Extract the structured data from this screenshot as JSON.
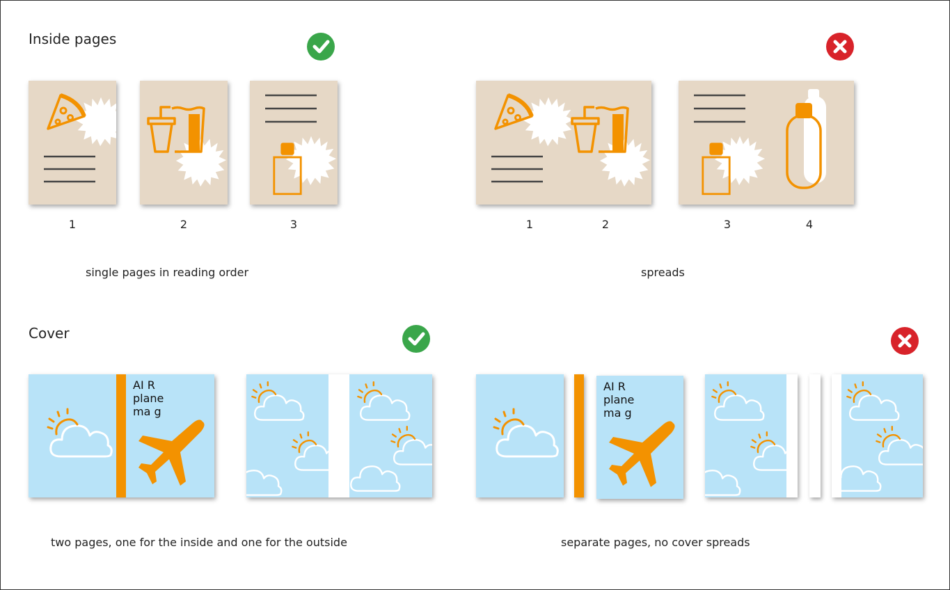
{
  "inside": {
    "heading": "Inside pages",
    "good_page_numbers": [
      "1",
      "2",
      "3"
    ],
    "good_caption": "single pages in reading order",
    "bad_page_numbers": [
      "1",
      "2",
      "3",
      "4"
    ],
    "bad_caption": "spreads"
  },
  "cover": {
    "heading": "Cover",
    "title_lines": [
      "AI R",
      "plane",
      "ma g"
    ],
    "good_caption": "two pages, one for the inside and one for the outside",
    "bad_caption": "separate pages, no cover spreads"
  },
  "colors": {
    "good": "#3aa64a",
    "bad": "#d8232a",
    "accent": "#f39200",
    "page": "#e6d8c6",
    "sky": "#b8e3f8"
  }
}
